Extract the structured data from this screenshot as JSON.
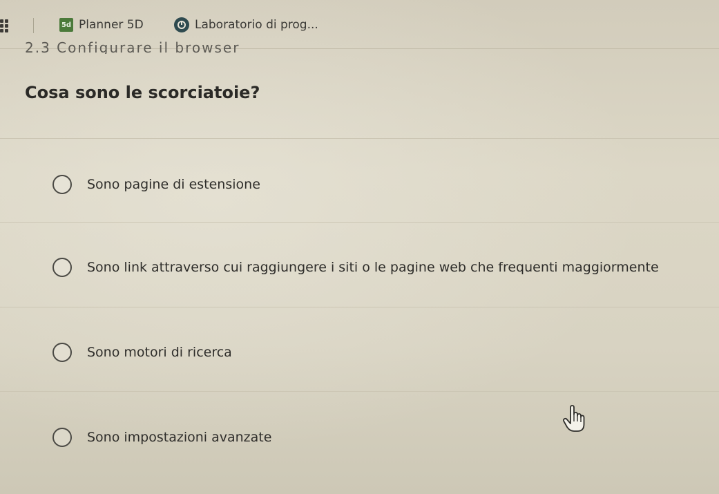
{
  "bookmarks": {
    "items": [
      {
        "label": "Planner 5D",
        "icon": "planner-5d-icon",
        "icon_text": "5d",
        "icon_color": "#4b7a3a"
      },
      {
        "label": "Laboratorio di prog...",
        "icon": "lab-icon",
        "icon_color": "#2e4a4f"
      }
    ]
  },
  "section": {
    "heading": "2.3 Configurare il browser"
  },
  "quiz": {
    "question": "Cosa sono le scorciatoie?",
    "options": [
      {
        "label": "Sono pagine di estensione",
        "selected": false
      },
      {
        "label": "Sono link attraverso cui raggiungere i siti o le pagine web che frequenti maggiormente",
        "selected": false
      },
      {
        "label": "Sono motori di ricerca",
        "selected": false
      },
      {
        "label": "Sono impostazioni avanzate",
        "selected": false
      }
    ]
  },
  "colors": {
    "background": "#d9d3c1",
    "text": "#2e2d2a"
  }
}
